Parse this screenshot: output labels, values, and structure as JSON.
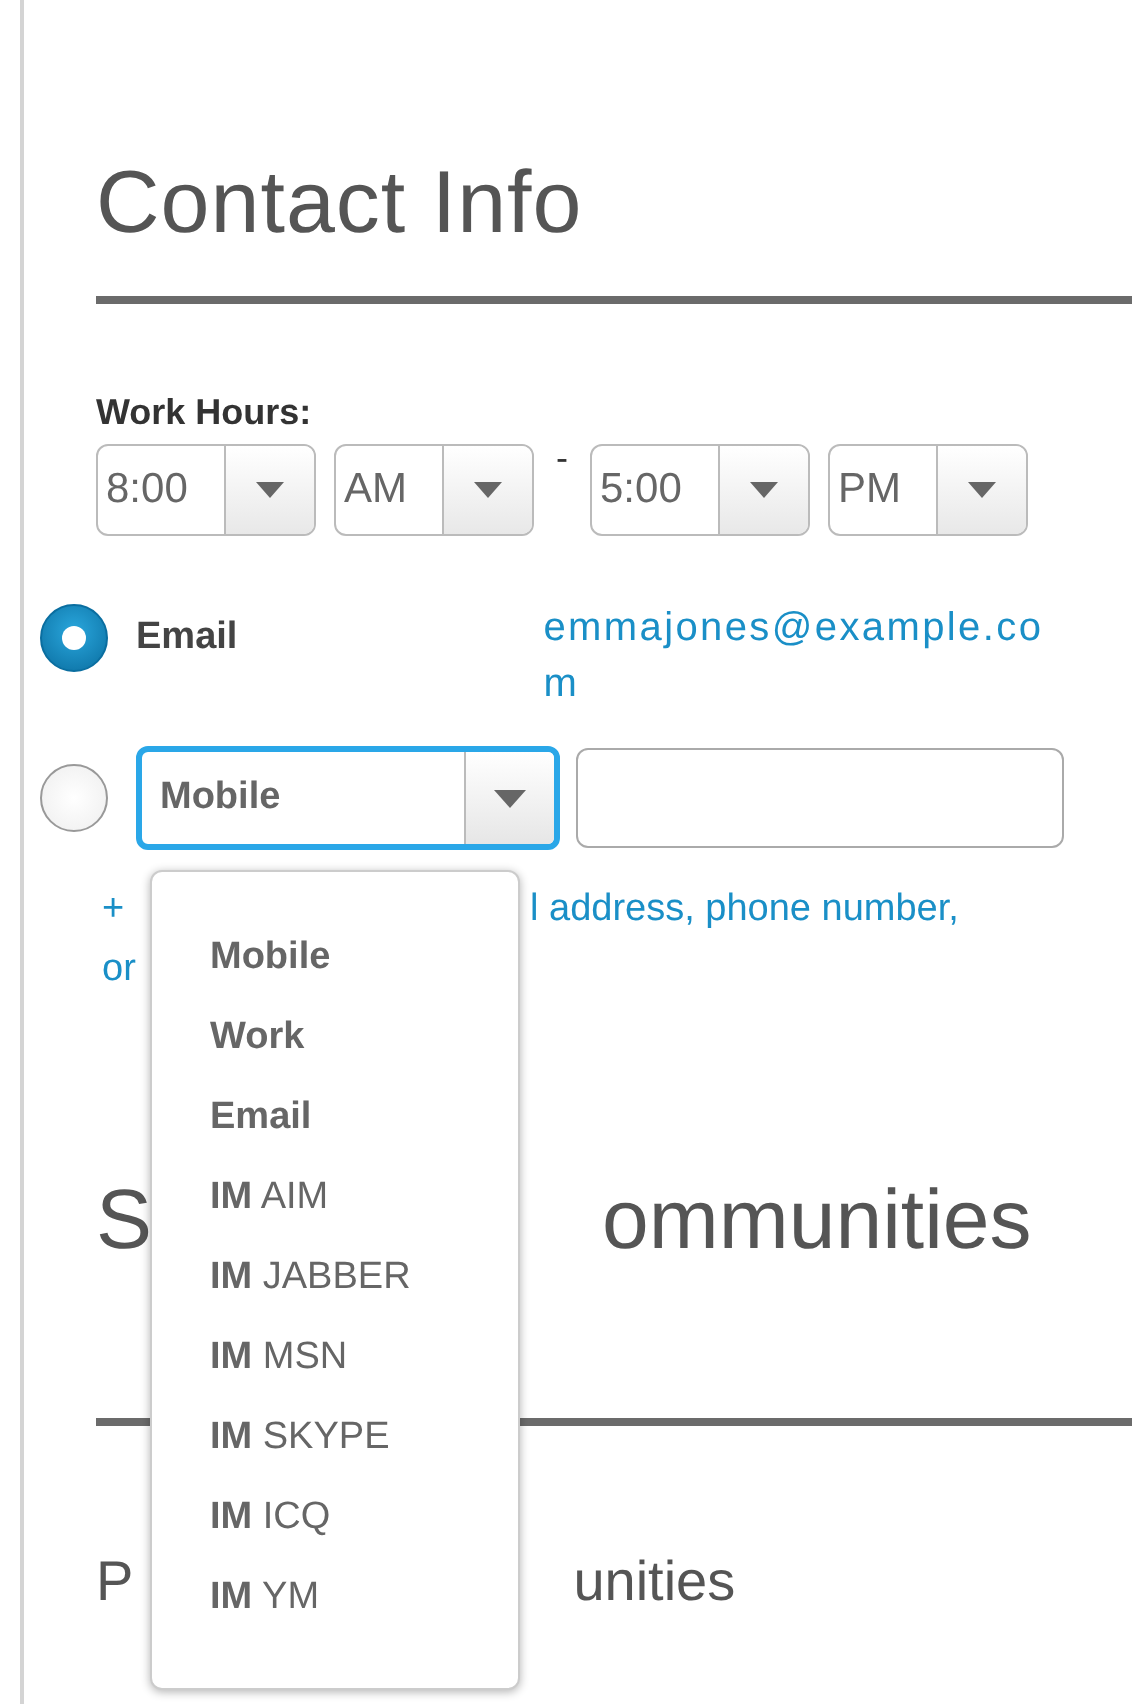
{
  "heading": "Contact Info",
  "work_hours": {
    "label": "Work Hours:",
    "selects": [
      {
        "value": "8:00"
      },
      {
        "value": "AM"
      },
      {
        "value": "5:00"
      },
      {
        "value": "PM"
      }
    ],
    "separator": "-"
  },
  "contacts": [
    {
      "kind": "static",
      "selected": true,
      "label": "Email",
      "value": "emmajones@example.com"
    },
    {
      "kind": "editable",
      "selected": false,
      "type_value": "Mobile",
      "focused": true
    }
  ],
  "add_link_fragments": [
    "+",
    "l address, phone number,",
    "or"
  ],
  "section_heading_fragments": [
    "S",
    "ommunities"
  ],
  "subheading_fragments": [
    "P",
    "unities"
  ],
  "dropdown_options": [
    {
      "kind": "plain",
      "label": "Mobile"
    },
    {
      "kind": "plain",
      "label": "Work"
    },
    {
      "kind": "plain",
      "label": "Email"
    },
    {
      "kind": "im",
      "prefix": "IM",
      "label": "AIM"
    },
    {
      "kind": "im",
      "prefix": "IM",
      "label": "JABBER"
    },
    {
      "kind": "im",
      "prefix": "IM",
      "label": "MSN"
    },
    {
      "kind": "im",
      "prefix": "IM",
      "label": "SKYPE"
    },
    {
      "kind": "im",
      "prefix": "IM",
      "label": "ICQ"
    },
    {
      "kind": "im",
      "prefix": "IM",
      "label": "YM"
    }
  ]
}
